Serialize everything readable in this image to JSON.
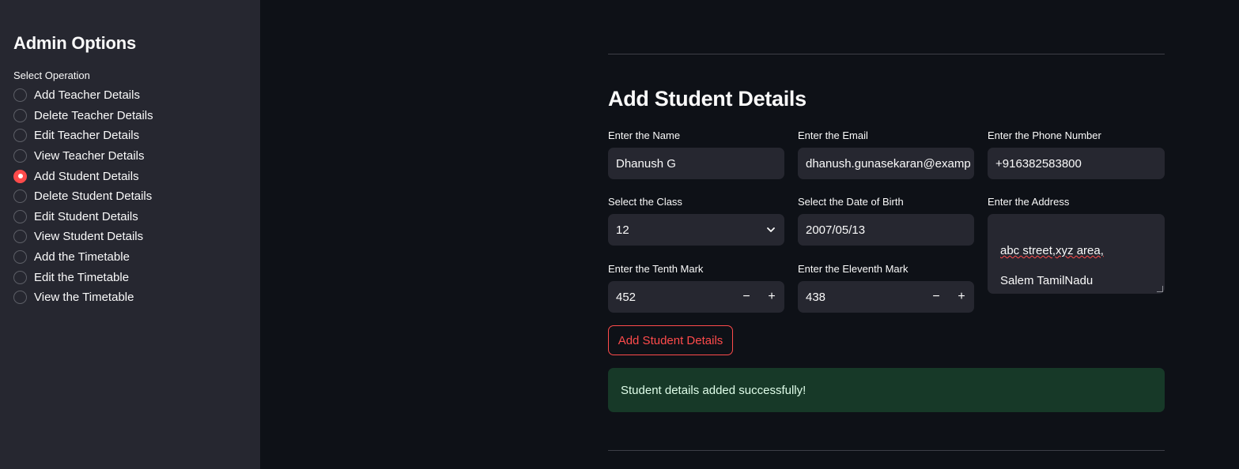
{
  "sidebar": {
    "title": "Admin Options",
    "group_label": "Select Operation",
    "options": [
      {
        "label": "Add Teacher Details",
        "selected": false
      },
      {
        "label": "Delete Teacher Details",
        "selected": false
      },
      {
        "label": "Edit Teacher Details",
        "selected": false
      },
      {
        "label": "View Teacher Details",
        "selected": false
      },
      {
        "label": "Add Student Details",
        "selected": true
      },
      {
        "label": "Delete Student Details",
        "selected": false
      },
      {
        "label": "Edit Student Details",
        "selected": false
      },
      {
        "label": "View Student Details",
        "selected": false
      },
      {
        "label": "Add the Timetable",
        "selected": false
      },
      {
        "label": "Edit the Timetable",
        "selected": false
      },
      {
        "label": "View the Timetable",
        "selected": false
      }
    ]
  },
  "form": {
    "title": "Add Student Details",
    "name": {
      "label": "Enter the Name",
      "value": "Dhanush G"
    },
    "email": {
      "label": "Enter the Email",
      "value": "dhanush.gunasekaran@examp"
    },
    "phone": {
      "label": "Enter the Phone Number",
      "value": "+916382583800"
    },
    "class": {
      "label": "Select the Class",
      "value": "12"
    },
    "dob": {
      "label": "Select the Date of Birth",
      "value": "2007/05/13"
    },
    "address": {
      "label": "Enter the Address",
      "line1": "abc street,xyz area,",
      "line2": "Salem TamilNadu"
    },
    "tenth": {
      "label": "Enter the Tenth Mark",
      "value": "452"
    },
    "eleventh": {
      "label": "Enter the Eleventh Mark",
      "value": "438"
    },
    "stepper": {
      "minus": "−",
      "plus": "+"
    },
    "submit_label": "Add Student Details",
    "success_message": "Student details added successfully!"
  },
  "colors": {
    "accent": "#ff4b4b",
    "success_bg": "#173928",
    "sidebar_bg": "#262730",
    "main_bg": "#0e1117"
  }
}
